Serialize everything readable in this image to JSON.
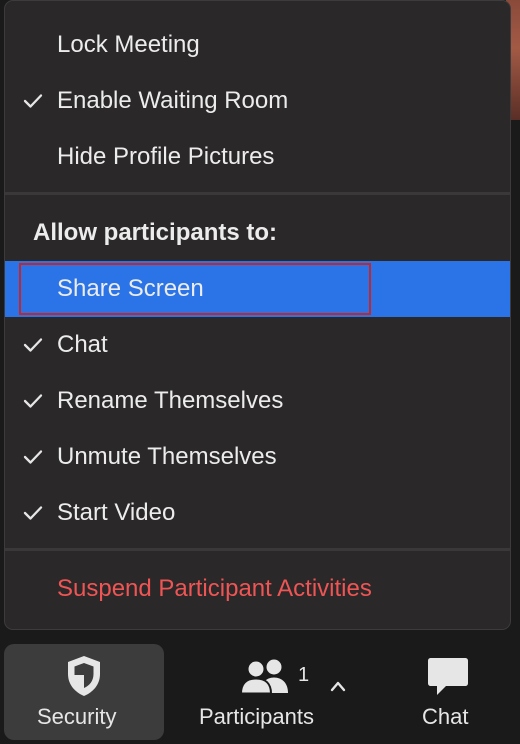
{
  "menu": {
    "items": [
      {
        "label": "Lock Meeting",
        "checked": false
      },
      {
        "label": "Enable Waiting Room",
        "checked": true
      },
      {
        "label": "Hide Profile Pictures",
        "checked": false
      }
    ],
    "section_header": "Allow participants to:",
    "permissions": [
      {
        "label": "Share Screen",
        "checked": false,
        "selected": true
      },
      {
        "label": "Chat",
        "checked": true
      },
      {
        "label": "Rename Themselves",
        "checked": true
      },
      {
        "label": "Unmute Themselves",
        "checked": true
      },
      {
        "label": "Start Video",
        "checked": true
      }
    ],
    "suspend_label": "Suspend Participant Activities"
  },
  "toolbar": {
    "security_label": "Security",
    "participants_label": "Participants",
    "participants_count": "1",
    "chat_label": "Chat"
  },
  "colors": {
    "menu_bg": "#2a2828",
    "selected_bg": "#2b74e8",
    "danger_text": "#ef5555",
    "highlight_border": "#c1272d",
    "toolbar_active_bg": "#3c3c3c"
  },
  "icons": {
    "check": "checkmark-icon",
    "security": "shield-icon",
    "participants": "people-icon",
    "chevron": "chevron-up-icon",
    "chat": "speech-bubble-icon"
  }
}
